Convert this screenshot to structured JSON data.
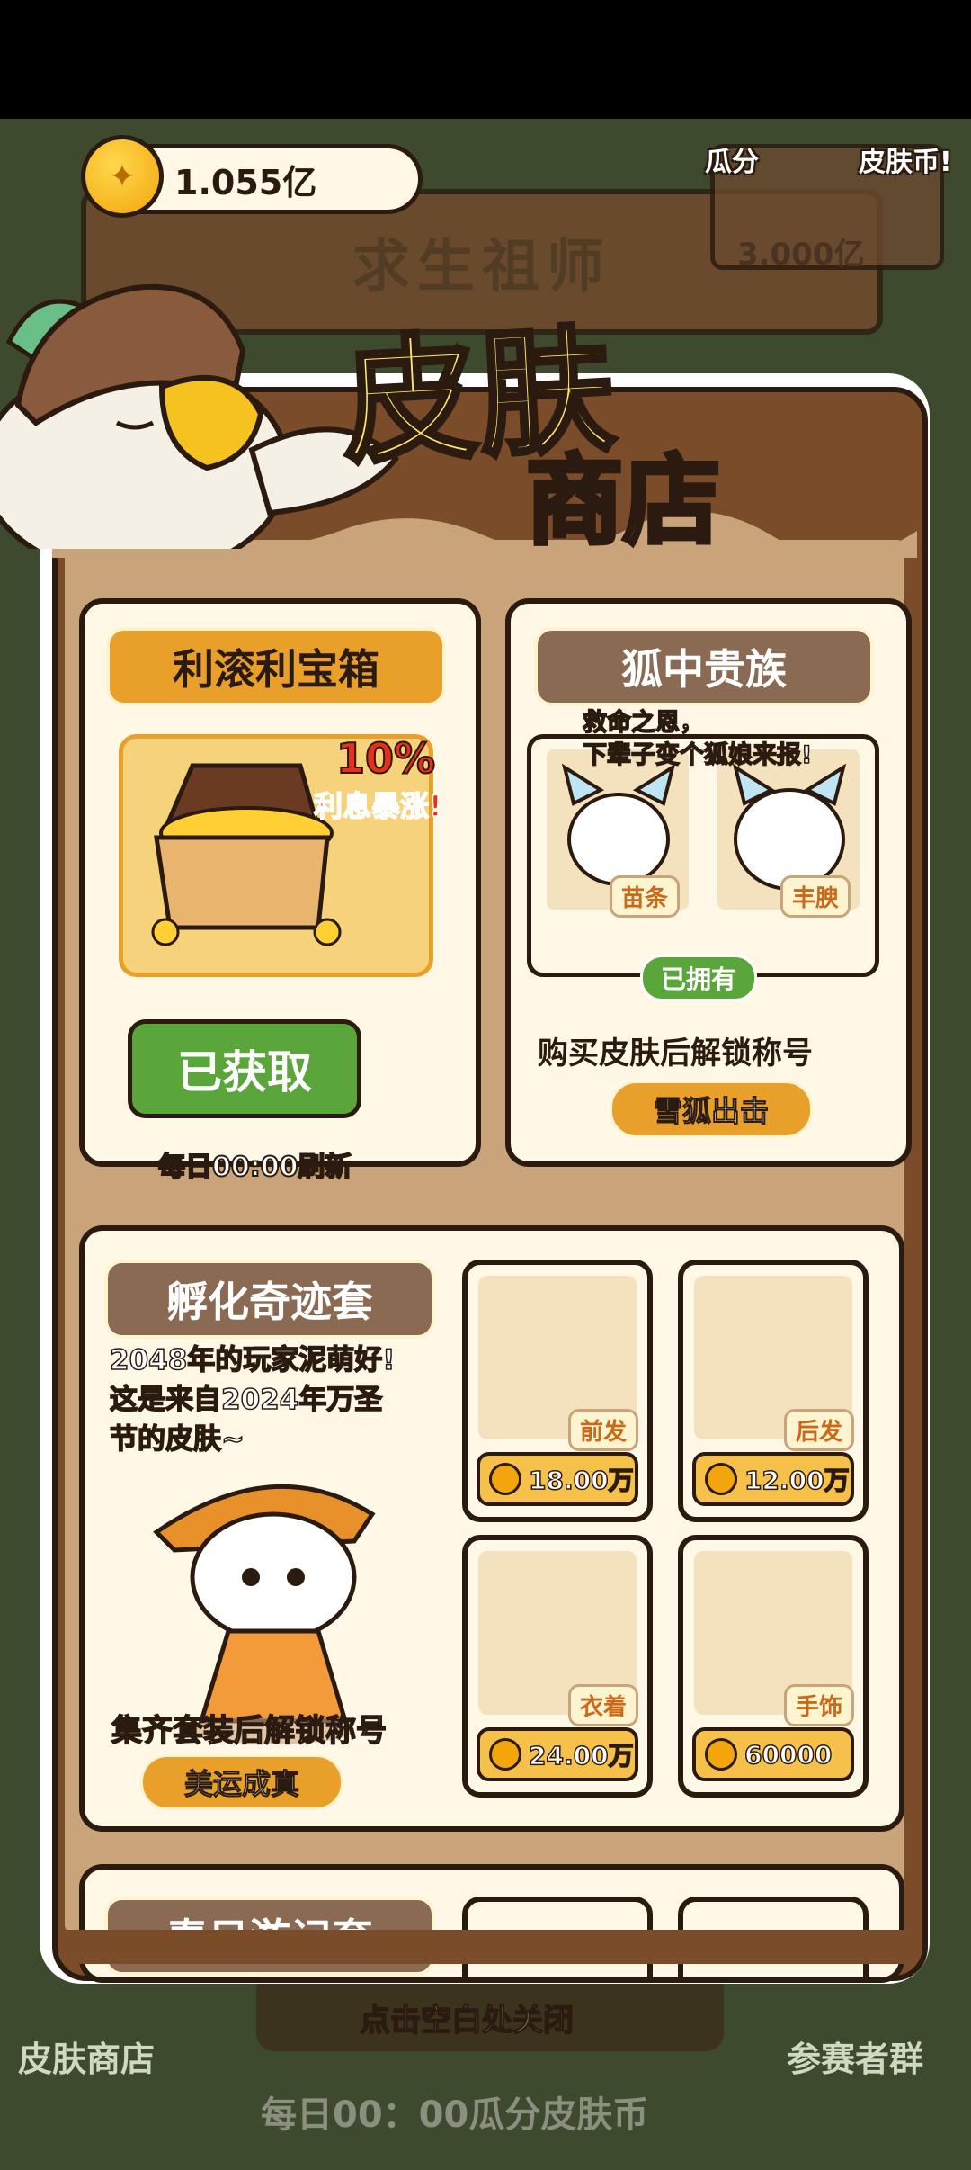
{
  "wallet": {
    "amount": "1.055亿"
  },
  "background": {
    "sign_title": "求生祖师",
    "pool_label_a": "瓜分",
    "pool_label_b": "皮肤币!",
    "pool_amount": "3.000亿",
    "left_label": "皮肤商店",
    "right_label": "参赛者群",
    "daily_text": "每日00：00瓜分皮肤币",
    "close_hint": "点击空白处关闭"
  },
  "title": {
    "line1": "皮肤",
    "line2": "商店"
  },
  "treasure_card": {
    "title": "利滚利宝箱",
    "badge_percent": "10%",
    "badge_text": "利息暴涨!",
    "button_label": "已获取",
    "refresh_text": "每日00:00刷新"
  },
  "fox_card": {
    "title": "狐中贵族",
    "quote": "救命之恩，\n下辈子变个狐娘来报!",
    "items": [
      {
        "label": "苗条"
      },
      {
        "label": "丰腴"
      }
    ],
    "owned_label": "已拥有",
    "unlock_text": "购买皮肤后解锁称号",
    "badge_title": "雪狐出击"
  },
  "hatch_card": {
    "title": "孵化奇迹套",
    "description": "2048年的玩家泥萌好!\n这是来自2024年万圣\n节的皮肤~",
    "unlock_text": "集齐套装后解锁称号",
    "badge_title": "美运成真",
    "items": [
      {
        "label": "前发",
        "price": "18.00万"
      },
      {
        "label": "后发",
        "price": "12.00万"
      },
      {
        "label": "衣着",
        "price": "24.00万"
      },
      {
        "label": "手饰",
        "price": "60000"
      }
    ]
  },
  "next_card": {
    "title": "春日游记套"
  },
  "colors": {
    "panel_brown": "#7a4c2a",
    "cream": "#fff8e6",
    "accent_orange": "#e8a02a",
    "owned_green": "#5aa63a"
  }
}
